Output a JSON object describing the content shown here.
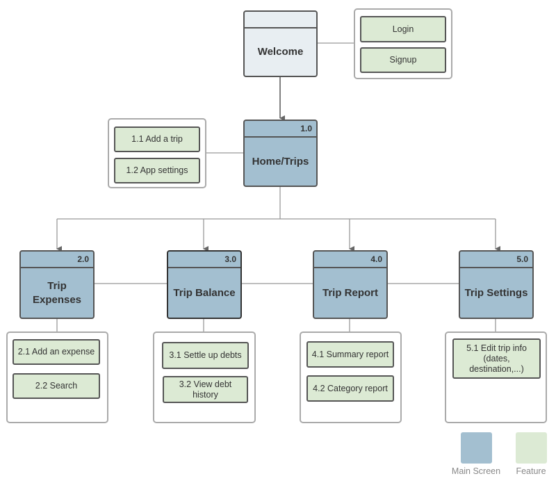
{
  "colors": {
    "main_screen": "#a3bfd0",
    "feature": "#dcead4",
    "welcome": "#e8eef2",
    "border": "#555555"
  },
  "welcome": {
    "title": "Welcome",
    "features": [
      "Login",
      "Signup"
    ]
  },
  "home": {
    "number": "1.0",
    "title": "Home/Trips",
    "features": [
      "1.1 Add a trip",
      "1.2 App settings"
    ]
  },
  "screens": [
    {
      "number": "2.0",
      "title": "Trip Expenses",
      "features": [
        "2.1 Add an expense",
        "2.2 Search"
      ]
    },
    {
      "number": "3.0",
      "title": "Trip Balance",
      "features": [
        "3.1 Settle up debts",
        "3.2 View debt history"
      ]
    },
    {
      "number": "4.0",
      "title": "Trip Report",
      "features": [
        "4.1 Summary report",
        "4.2 Category report"
      ]
    },
    {
      "number": "5.0",
      "title": "Trip Settings",
      "features": [
        "5.1 Edit trip info (dates, destination,...)"
      ]
    }
  ],
  "legend": {
    "main_screen": "Main Screen",
    "feature": "Feature"
  }
}
